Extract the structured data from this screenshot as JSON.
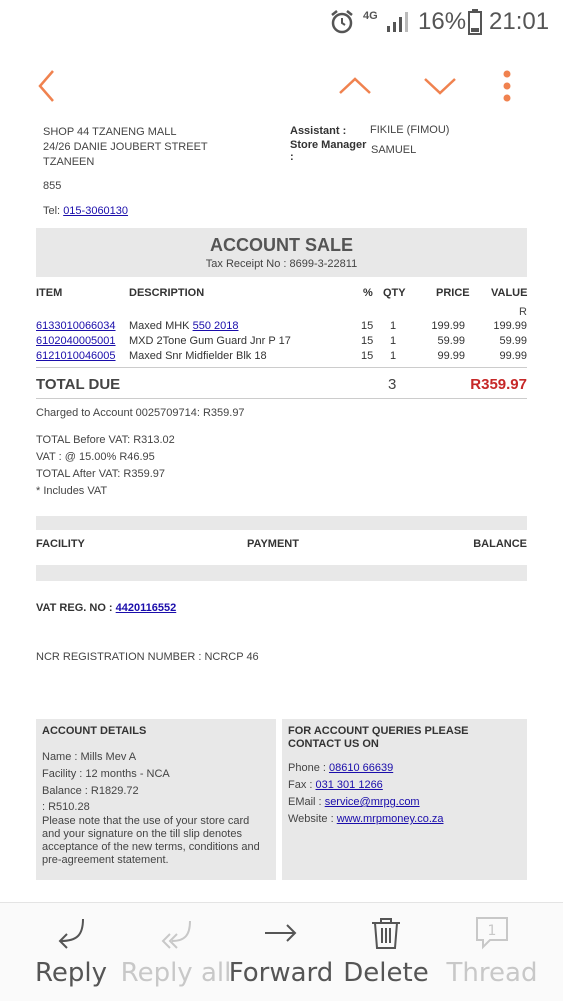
{
  "status_bar": {
    "network": "4G",
    "battery": "16%",
    "time": "21:01"
  },
  "toolbar": {
    "back_icon": "chevron-left-icon",
    "prev_icon": "chevron-up-icon",
    "next_icon": "chevron-down-icon",
    "more_icon": "kebab-menu-icon",
    "accent_color": "#f0824f"
  },
  "store": {
    "address_line1": "SHOP 44 TZANENG MALL",
    "address_line2": "24/26 DANIE JOUBERT STREET",
    "address_line3": "TZANEEN",
    "code": "855",
    "tel_label": "Tel: ",
    "tel": "015-3060130",
    "assistant_label": "Assistant :",
    "assistant": "FIKILE (FIMOU)",
    "manager_label": "Store Manager",
    "manager_colon": ":",
    "manager": "SAMUEL"
  },
  "receipt": {
    "title": "ACCOUNT SALE",
    "subtitle": "Tax Receipt No : 8699-3-22811",
    "headers": {
      "item": "ITEM",
      "description": "DESCRIPTION",
      "percent": "%",
      "qty": "QTY",
      "price": "PRICE",
      "value": "VALUE",
      "value_unit": "R"
    },
    "rows": [
      {
        "item": "6133010066034",
        "desc": "Maxed MHK ",
        "desc_link": "550 2018",
        "pct": "15",
        "qty": "1",
        "price": "199.99",
        "value": "199.99"
      },
      {
        "item": "6102040005001",
        "desc": "MXD 2Tone Gum Guard Jnr P 17",
        "desc_link": "",
        "pct": "15",
        "qty": "1",
        "price": "59.99",
        "value": "59.99"
      },
      {
        "item": "6121010046005",
        "desc": "Maxed Snr Midfielder Blk 18",
        "desc_link": "",
        "pct": "15",
        "qty": "1",
        "price": "99.99",
        "value": "99.99"
      }
    ],
    "total_label": "TOTAL DUE",
    "total_qty": "3",
    "total_amount": "R359.97",
    "total_color": "#c62828",
    "charged": "Charged to Account 0025709714: R359.97",
    "vat_before": "TOTAL Before VAT: R313.02",
    "vat": "VAT : @ 15.00% R46.95",
    "vat_after": "TOTAL After VAT: R359.97",
    "includes_vat": "* Includes VAT"
  },
  "facility_table": {
    "facility": "FACILITY",
    "payment": "PAYMENT",
    "balance": "BALANCE"
  },
  "vat_reg": {
    "label": "VAT REG. NO : ",
    "number": "4420116552"
  },
  "ncr": "NCR REGISTRATION NUMBER : NCRCP 46",
  "account_details": {
    "heading": "ACCOUNT DETAILS",
    "name": "Name : Mills Mev A",
    "facility": "Facility : 12 months - NCA",
    "balance": "Balance : R1829.72",
    "amount": ": R510.28",
    "note": "Please note that the use of your store card and your signature on the till slip denotes acceptance of the new terms, conditions and pre-agreement statement."
  },
  "contact": {
    "heading": "FOR ACCOUNT QUERIES PLEASE CONTACT US ON",
    "phone_label": "Phone : ",
    "phone": "08610 66639",
    "fax_label": "Fax : ",
    "fax": "031 301 1266",
    "email_label": "EMail : ",
    "email": "service@mrpg.com",
    "website_label": "Website : ",
    "website": "www.mrpmoney.co.za"
  },
  "bottom_bar": {
    "reply": "Reply",
    "reply_all": "Reply all",
    "forward": "Forward",
    "delete": "Delete",
    "thread": "Thread",
    "thread_count": "1"
  }
}
